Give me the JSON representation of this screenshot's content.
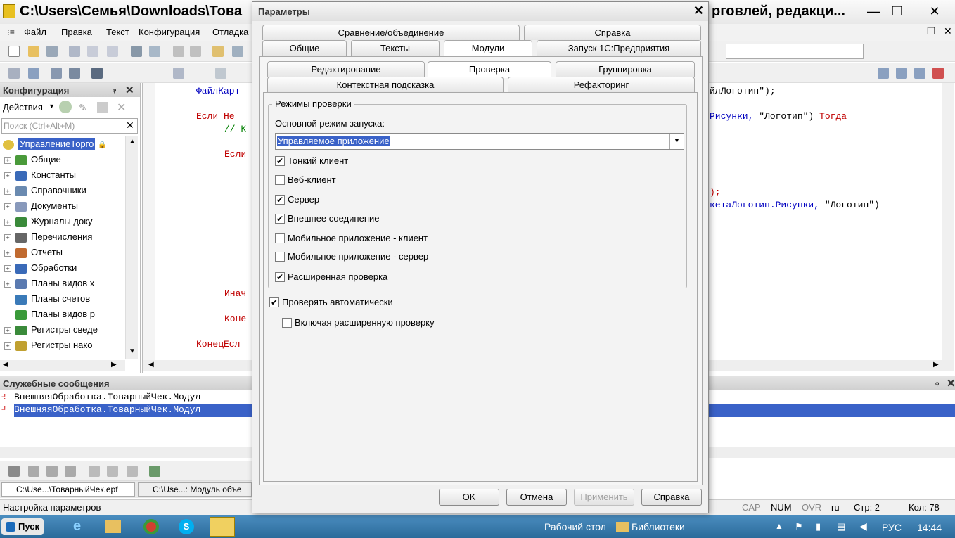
{
  "window": {
    "title_left": "C:\\Users\\Семья\\Downloads\\Това",
    "title_right": "рговлей, редакци..."
  },
  "menu": [
    "Файл",
    "Правка",
    "Текст",
    "Конфигурация",
    "Отладка"
  ],
  "left_panel": {
    "title": "Конфигурация",
    "actions_label": "Действия",
    "search_placeholder": "Поиск (Ctrl+Alt+M)",
    "root": "УправлениеТорго",
    "items": [
      {
        "label": "Общие",
        "color": "#4a9a3a"
      },
      {
        "label": "Константы",
        "color": "#3a6ab8"
      },
      {
        "label": "Справочники",
        "color": "#6a8ab0"
      },
      {
        "label": "Документы",
        "color": "#8899bb"
      },
      {
        "label": "Журналы доку",
        "color": "#3a8a3a"
      },
      {
        "label": "Перечисления",
        "color": "#666666"
      },
      {
        "label": "Отчеты",
        "color": "#c06a30"
      },
      {
        "label": "Обработки",
        "color": "#3a6ab8"
      },
      {
        "label": "Планы видов х",
        "color": "#5a7ab0"
      },
      {
        "label": "Планы счетов",
        "color": "#3a7ab8"
      },
      {
        "label": "Планы видов р",
        "color": "#3a9a3a"
      },
      {
        "label": "Регистры сведе",
        "color": "#3a8a3a"
      },
      {
        "label": "Регистры нако",
        "color": "#c0a030"
      }
    ]
  },
  "code": {
    "line1a": "ФайлКарт",
    "line1b": "йлЛоготип\");",
    "line2_kw": "Если Не",
    "line2b_id": "Рисунки,",
    "line2b_str": " \"Логотип\") ",
    "line2b_kw": "Тогда",
    "line3": "// К",
    "line4": "Если",
    "line5": ");",
    "line6_id": "кетаЛоготип.Рисунки,",
    "line6_str": " \"Логотип\")",
    "line7": "Инач",
    "line8": "Коне",
    "line9": "КонецЕсл"
  },
  "messages": {
    "title": "Служебные сообщения",
    "lines": [
      "ВнешняяОбработка.ТоварныйЧек.Модул",
      "ВнешняяОбработка.ТоварныйЧек.Модул"
    ]
  },
  "bottom_tabs": [
    "C:\\Use...\\ТоварныйЧек.epf",
    "C:\\Use...: Модуль объе"
  ],
  "status": {
    "text": "Настройка параметров",
    "cap": "CAP",
    "num": "NUM",
    "ovr": "OVR",
    "lang": "ru",
    "line": "Стр: 2",
    "col": "Кол: 78"
  },
  "taskbar": {
    "start": "Пуск",
    "desktop": "Рабочий стол",
    "libraries": "Библиотеки",
    "lang": "РУС",
    "time": "14:44"
  },
  "dialog": {
    "title": "Параметры",
    "tabs_row1": [
      "Сравнение/объединение",
      "Справка"
    ],
    "tabs_row2": [
      "Общие",
      "Тексты",
      "Модули",
      "Запуск 1С:Предприятия"
    ],
    "subtabs_row1": [
      "Редактирование",
      "Проверка",
      "Группировка"
    ],
    "subtabs_row2": [
      "Контекстная подсказка",
      "Рефакторинг"
    ],
    "group_title": "Режимы проверки",
    "mode_label": "Основной режим запуска:",
    "mode_value": "Управляемое приложение",
    "checks": [
      {
        "label": "Тонкий клиент",
        "checked": true
      },
      {
        "label": "Веб-клиент",
        "checked": false
      },
      {
        "label": "Сервер",
        "checked": true
      },
      {
        "label": "Внешнее соединение",
        "checked": true
      },
      {
        "label": "Мобильное приложение - клиент",
        "checked": false
      },
      {
        "label": "Мобильное приложение - сервер",
        "checked": false
      },
      {
        "label": "Расширенная проверка",
        "checked": true
      }
    ],
    "auto_check": {
      "label": "Проверять автоматически",
      "checked": true
    },
    "ext_check": {
      "label": "Включая расширенную проверку",
      "checked": false
    },
    "buttons": {
      "ok": "OK",
      "cancel": "Отмена",
      "apply": "Применить",
      "help": "Справка"
    }
  }
}
